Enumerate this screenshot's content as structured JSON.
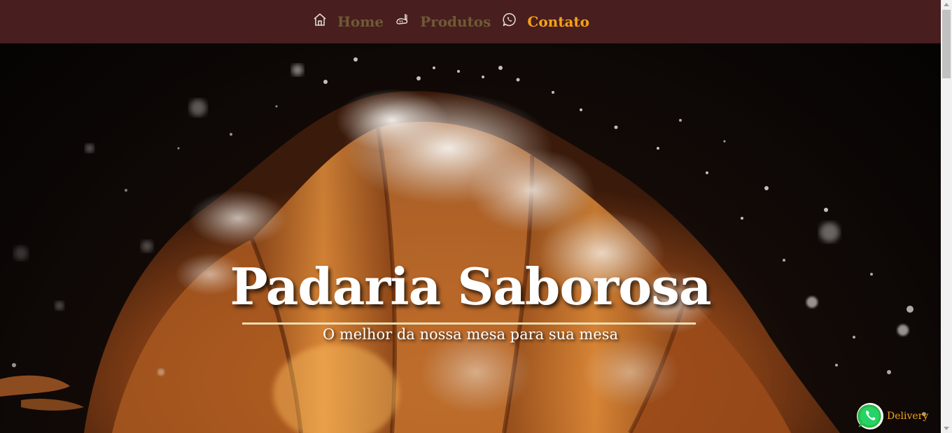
{
  "nav": {
    "items": [
      {
        "label": "Home",
        "icon": "home-icon",
        "active": false
      },
      {
        "label": "Produtos",
        "icon": "bread-icon",
        "active": false
      },
      {
        "label": "Contato",
        "icon": "whatsapp-icon",
        "active": true
      }
    ]
  },
  "hero": {
    "title": "Padaria Saborosa",
    "subtitle": "O melhor da nossa mesa para sua mesa"
  },
  "delivery": {
    "label": "Delivery",
    "icon": "whatsapp-icon"
  },
  "colors": {
    "navbar_bg": "#481e1e",
    "nav_text": "#6f5a36",
    "accent": "#f5a21a",
    "rule": "#f0deb0"
  }
}
